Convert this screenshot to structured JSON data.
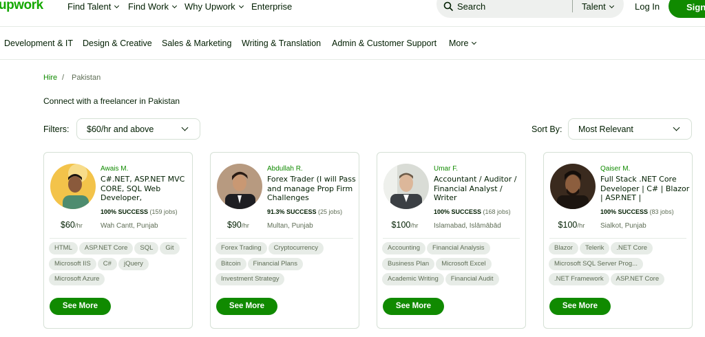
{
  "brand": {
    "logo": "upwork",
    "accent": "#14a800",
    "button_green": "#108a00"
  },
  "topnav": {
    "items": [
      "Find Talent",
      "Find Work",
      "Why Upwork",
      "Enterprise"
    ],
    "search_placeholder": "Search",
    "search_scope": "Talent",
    "login": "Log In",
    "signup": "Sign"
  },
  "categories": [
    "Development & IT",
    "Design & Creative",
    "Sales & Marketing",
    "Writing & Translation",
    "Admin & Customer Support",
    "More"
  ],
  "breadcrumb": {
    "hire": "Hire",
    "separator": "/",
    "current": "Pakistan"
  },
  "connect_text": "Connect with a freelancer in Pakistan",
  "filters": {
    "label": "Filters:",
    "value": "$60/hr and above"
  },
  "sort": {
    "label": "Sort By:",
    "value": "Most Relevant"
  },
  "cards": [
    {
      "name": "Awais M.",
      "title": "C#.NET, ASP.NET MVC CORE, SQL Web Developer,",
      "success": "100% SUCCESS",
      "jobs": "(159 jobs)",
      "rate": "$60",
      "per": "/hr",
      "location": "Wah Cantt, Punjab",
      "skills": [
        "HTML",
        "ASP.NET Core",
        "SQL",
        "Git",
        "Microsoft IIS",
        "C#",
        "jQuery",
        "Microsoft Azure"
      ],
      "button": "See More"
    },
    {
      "name": "Abdullah R.",
      "title": "Forex Trader (I will Pass and manage Prop Firm Challenges",
      "success": "91.3% SUCCESS",
      "jobs": "(25 jobs)",
      "rate": "$90",
      "per": "/hr",
      "location": "Multan, Punjab",
      "skills": [
        "Forex Trading",
        "Cryptocurrency",
        "Bitcoin",
        "Financial Plans",
        "Investment Strategy"
      ],
      "button": "See More"
    },
    {
      "name": "Umar F.",
      "title": "Accountant / Auditor / Financial Analyst / Writer",
      "success": "100% SUCCESS",
      "jobs": "(168 jobs)",
      "rate": "$100",
      "per": "/hr",
      "location": "Islamabad, Islāmābād",
      "skills": [
        "Accounting",
        "Financial Analysis",
        "Business Plan",
        "Microsoft Excel",
        "Academic Writing",
        "Financial Audit"
      ],
      "button": "See More"
    },
    {
      "name": "Qaiser M.",
      "title": "Full Stack .NET Core Developer | C# | Blazor | ASP.NET |",
      "success": "100% SUCCESS",
      "jobs": "(83 jobs)",
      "rate": "$100",
      "per": "/hr",
      "location": "Sialkot, Punjab",
      "skills": [
        "Blazor",
        "Telerik",
        ".NET Core",
        "Microsoft SQL Server Prog...",
        ".NET Framework",
        "ASP.NET Core"
      ],
      "button": "See More"
    }
  ]
}
